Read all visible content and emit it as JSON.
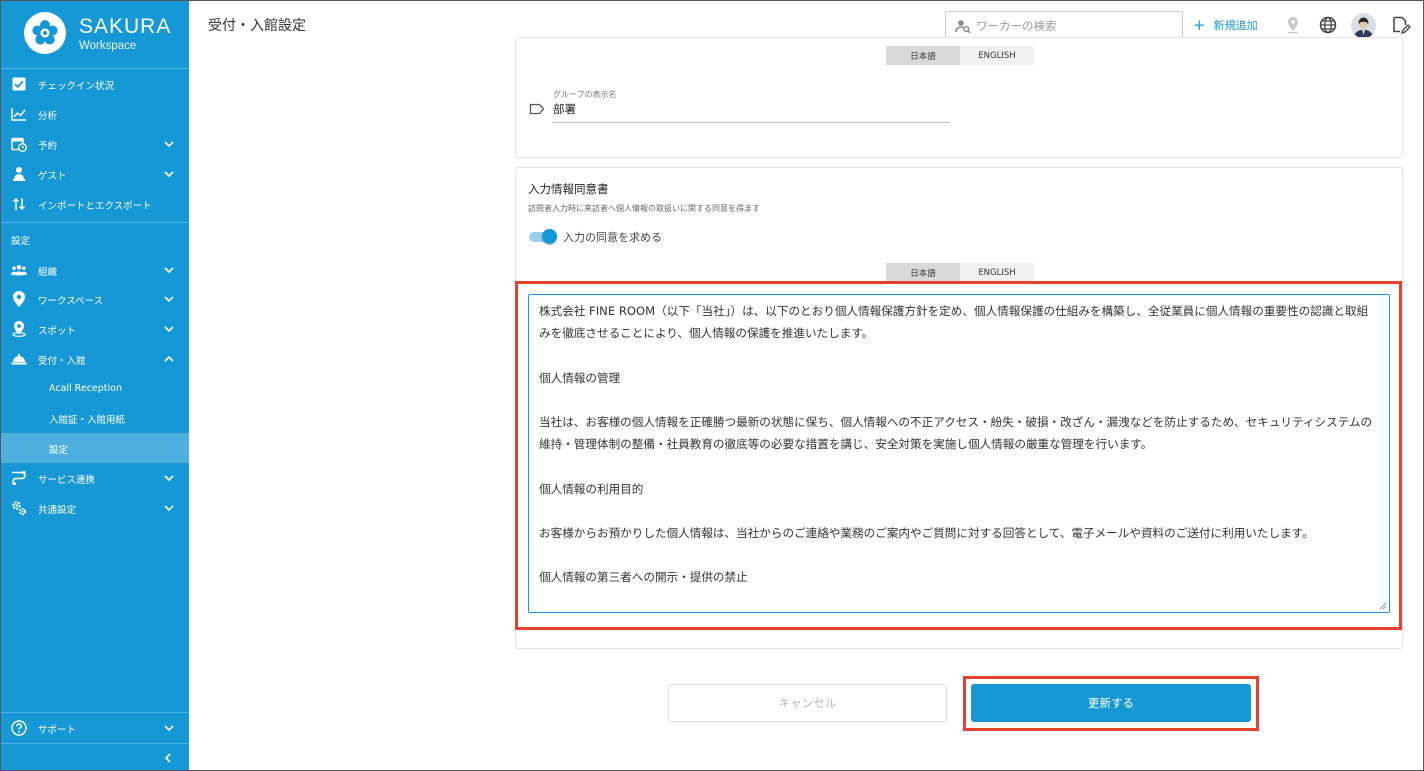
{
  "brand": {
    "name": "SAKURA",
    "sub": "Workspace"
  },
  "sidebar": {
    "items": [
      {
        "label": "チェックイン状況"
      },
      {
        "label": "分析"
      },
      {
        "label": "予約"
      },
      {
        "label": "ゲスト"
      },
      {
        "label": "インポートとエクスポート"
      }
    ],
    "settings_label": "設定",
    "settings_items": [
      {
        "label": "組織"
      },
      {
        "label": "ワークスペース"
      },
      {
        "label": "スポット"
      },
      {
        "label": "受付・入館"
      }
    ],
    "reception_sub": [
      {
        "label": "Acall Reception"
      },
      {
        "label": "入館証・入館用紙"
      },
      {
        "label": "設定"
      }
    ],
    "more_items": [
      {
        "label": "サービス連携"
      },
      {
        "label": "共通設定"
      }
    ],
    "support_label": "サポート"
  },
  "header": {
    "title": "受付・入館設定",
    "search_placeholder": "ワーカーの検索",
    "add_new": "新規追加"
  },
  "group_card": {
    "tabs": [
      "日本語",
      "ENGLISH"
    ],
    "field_label": "グループの表示名",
    "field_value": "部署"
  },
  "consent_card": {
    "title": "入力情報同意書",
    "description": "訪問者入力時に来訪者へ個人情報の取扱いに関する同意を得ます",
    "toggle_label": "入力の同意を求める",
    "tabs": [
      "日本語",
      "ENGLISH"
    ],
    "body": [
      "株式会社 FINE ROOM（以下「当社」）は、以下のとおり個人情報保護方針を定め、個人情報保護の仕組みを構築し、全従業員に個人情報の重要性の認識と取組みを徹底させることにより、個人情報の保護を推進いたします。",
      "",
      "個人情報の管理",
      "",
      "当社は、お客様の個人情報を正確勝つ最新の状態に保ち、個人情報への不正アクセス・紛失・破損・改ざん・漏洩などを防止するため、セキュリティシステムの維持・管理体制の整備・社員教育の徹底等の必要な措置を講じ、安全対策を実施し個人情報の厳重な管理を行います。",
      "",
      "個人情報の利用目的",
      "",
      "お客様からお預かりした個人情報は、当社からのご連絡や業務のご案内やご質問に対する回答として、電子メールや資料のご送付に利用いたします。",
      "",
      "個人情報の第三者への開示・提供の禁止"
    ]
  },
  "buttons": {
    "cancel": "キャンセル",
    "update": "更新する"
  },
  "colors": {
    "brand": "#1698d6",
    "highlight": "#e8402f"
  }
}
